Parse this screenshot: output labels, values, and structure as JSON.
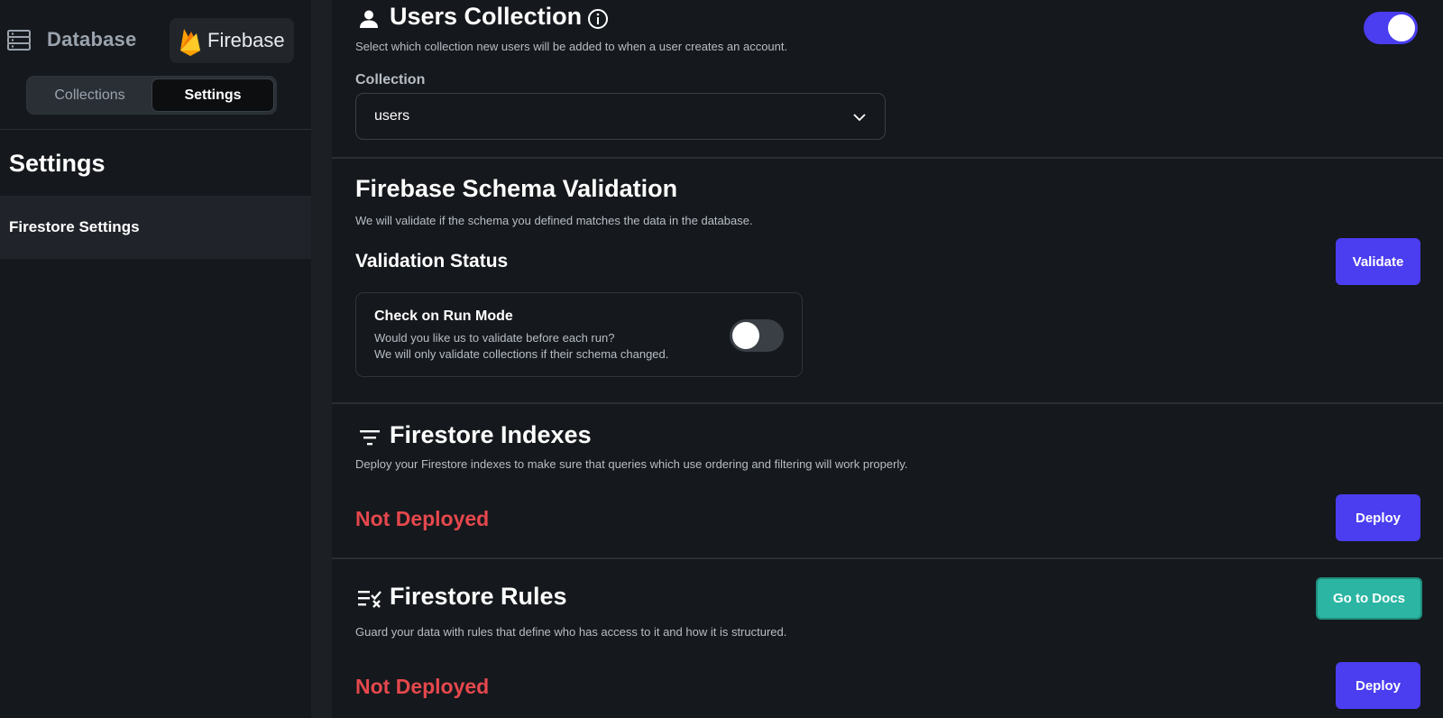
{
  "sidebar": {
    "app_title": "Database",
    "brand": "Firebase",
    "tabs": {
      "collections": "Collections",
      "settings": "Settings"
    },
    "heading": "Settings",
    "items": [
      {
        "label": "Firestore Settings",
        "selected": true
      }
    ]
  },
  "users_collection": {
    "title": "Users Collection",
    "description": "Select which collection new users will be added to when a user creates an account.",
    "enabled": true,
    "field_label": "Collection",
    "selected_value": "users",
    "icons": [
      "person-icon",
      "info-icon",
      "chevron-down-icon"
    ]
  },
  "schema_validation": {
    "title": "Firebase Schema Validation",
    "description": "We will validate if the schema you defined matches the data in the database.",
    "status_heading": "Validation Status",
    "validate_label": "Validate",
    "run_mode": {
      "title": "Check on Run Mode",
      "line1": "Would you like us to validate before each run?",
      "line2": "We will only validate collections if their schema changed.",
      "enabled": false
    }
  },
  "indexes": {
    "title": "Firestore Indexes",
    "description": "Deploy your Firestore indexes to make sure that queries which use ordering and filtering will work properly.",
    "status": "Not Deployed",
    "deploy_label": "Deploy",
    "icon": "filter-icon"
  },
  "rules": {
    "title": "Firestore Rules",
    "description": "Guard your data with rules that define who has access to it and how it is structured.",
    "status": "Not Deployed",
    "deploy_label": "Deploy",
    "docs_label": "Go to Docs",
    "icon": "rules-checklist-icon"
  },
  "colors": {
    "accent": "#4b3df0",
    "teal": "#2bb5a2",
    "error": "#e5484d",
    "background": "#15181c"
  }
}
